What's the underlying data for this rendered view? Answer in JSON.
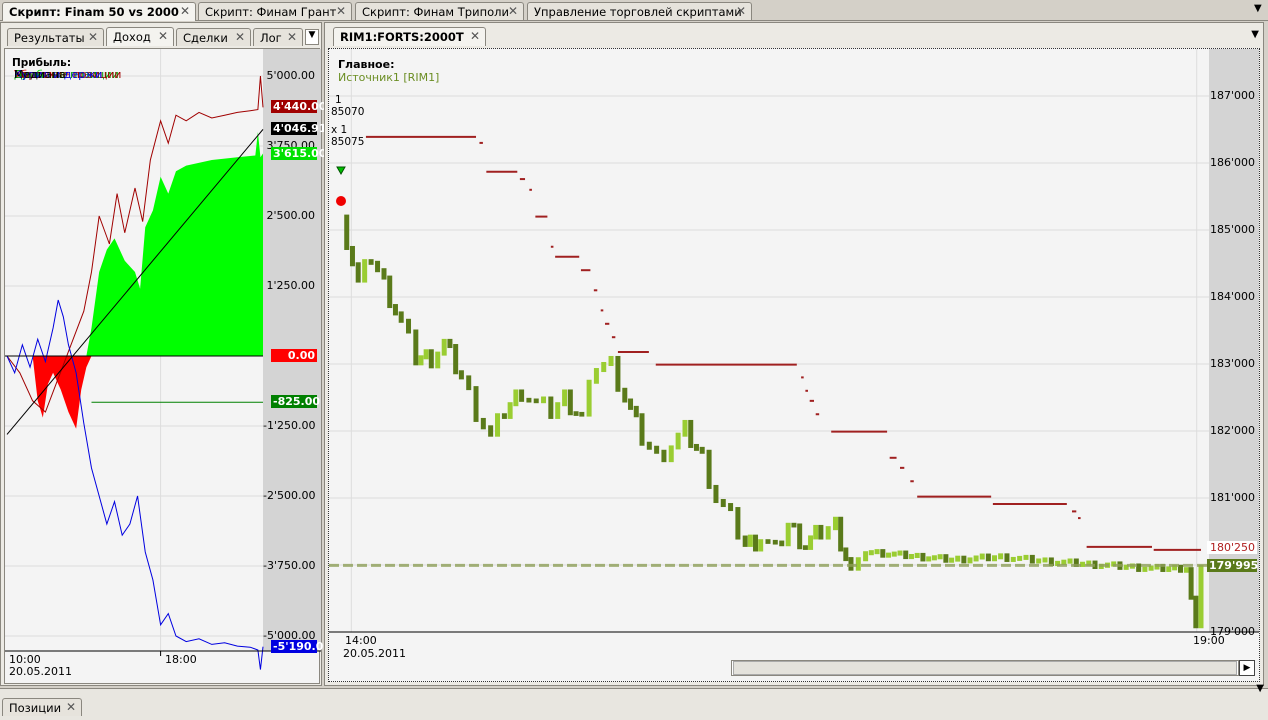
{
  "top_tabs": [
    {
      "label": "Скрипт: Finam 50 vs 2000",
      "active": true
    },
    {
      "label": "Скрипт: Финам Грант"
    },
    {
      "label": "Скрипт: Финам Триполи"
    },
    {
      "label": "Управление торговлей скриптами"
    }
  ],
  "left": {
    "tabs": [
      {
        "label": "Результаты"
      },
      {
        "label": "Доход",
        "active": true
      },
      {
        "label": "Сделки"
      },
      {
        "label": "Лог"
      }
    ],
    "legend": {
      "title": "Прибыль:",
      "items": [
        {
          "label": "Прибыль",
          "color": "#00e000"
        },
        {
          "label": "Убыток",
          "color": "#e00000"
        },
        {
          "label": "Длинные позиции",
          "color": "#00a000"
        },
        {
          "label": "Короткие позиции",
          "color": "#a00000"
        },
        {
          "label": "Купил и держи",
          "color": "#0000e0"
        },
        {
          "label": "Медиана",
          "color": "#000000"
        }
      ]
    },
    "y_ticks": [
      "5'000.00",
      "3'750.00",
      "2'500.00",
      "1'250.00",
      "-1'250.00",
      "-2'500.00",
      "-3'750.00",
      "-5'000.00"
    ],
    "value_boxes": {
      "profit": "4'440.00",
      "trend": "4'046.91",
      "long": "3'615.00",
      "zero": "0.00",
      "median": "-825.00",
      "buyhold": "-5'190.00"
    },
    "x_ticks": [
      "10:00",
      "18:00"
    ],
    "date": "20.05.2011"
  },
  "chart_data": [
    {
      "type": "area",
      "name": "equity",
      "ylim": [
        -5600,
        5000
      ],
      "x_range": [
        0,
        100
      ],
      "profit": [
        [
          0,
          0
        ],
        [
          5,
          -300
        ],
        [
          10,
          -800
        ],
        [
          15,
          -1000
        ],
        [
          20,
          -400
        ],
        [
          25,
          200
        ],
        [
          30,
          800
        ],
        [
          33,
          1500
        ],
        [
          36,
          2500
        ],
        [
          40,
          2000
        ],
        [
          43,
          2900
        ],
        [
          46,
          2200
        ],
        [
          50,
          3000
        ],
        [
          53,
          2400
        ],
        [
          56,
          3500
        ],
        [
          60,
          4200
        ],
        [
          63,
          3800
        ],
        [
          66,
          4300
        ],
        [
          70,
          4200
        ],
        [
          75,
          4350
        ],
        [
          80,
          4250
        ],
        [
          85,
          4300
        ],
        [
          90,
          4350
        ],
        [
          95,
          4380
        ],
        [
          98,
          4400
        ],
        [
          99,
          5000
        ],
        [
          100,
          4440
        ]
      ],
      "buyhold": [
        [
          0,
          0
        ],
        [
          3,
          -300
        ],
        [
          6,
          200
        ],
        [
          9,
          -200
        ],
        [
          12,
          300
        ],
        [
          15,
          -100
        ],
        [
          18,
          500
        ],
        [
          20,
          1000
        ],
        [
          22,
          700
        ],
        [
          24,
          200
        ],
        [
          27,
          -300
        ],
        [
          30,
          -1200
        ],
        [
          33,
          -2000
        ],
        [
          36,
          -2500
        ],
        [
          39,
          -3000
        ],
        [
          42,
          -2600
        ],
        [
          45,
          -3200
        ],
        [
          48,
          -3000
        ],
        [
          51,
          -2500
        ],
        [
          54,
          -3500
        ],
        [
          57,
          -4000
        ],
        [
          60,
          -4800
        ],
        [
          63,
          -4600
        ],
        [
          66,
          -5000
        ],
        [
          70,
          -5100
        ],
        [
          75,
          -5050
        ],
        [
          80,
          -5150
        ],
        [
          85,
          -5120
        ],
        [
          90,
          -5180
        ],
        [
          95,
          -5200
        ],
        [
          98,
          -5250
        ],
        [
          99,
          -5600
        ],
        [
          100,
          -5190
        ]
      ],
      "long": [
        [
          0,
          0
        ],
        [
          31,
          0
        ],
        [
          33,
          500
        ],
        [
          36,
          1500
        ],
        [
          39,
          1900
        ],
        [
          42,
          2100
        ],
        [
          46,
          1700
        ],
        [
          50,
          1500
        ],
        [
          52,
          1200
        ],
        [
          54,
          2300
        ],
        [
          57,
          2600
        ],
        [
          60,
          3200
        ],
        [
          63,
          2900
        ],
        [
          66,
          3300
        ],
        [
          70,
          3400
        ],
        [
          80,
          3500
        ],
        [
          90,
          3550
        ],
        [
          97,
          3580
        ],
        [
          98,
          4000
        ],
        [
          99,
          3550
        ],
        [
          100,
          3615
        ]
      ],
      "short": [
        [
          0,
          0
        ],
        [
          10,
          0
        ],
        [
          12,
          -800
        ],
        [
          14,
          -1100
        ],
        [
          16,
          -500
        ],
        [
          18,
          -300
        ],
        [
          21,
          -600
        ],
        [
          24,
          -1000
        ],
        [
          27,
          -1300
        ],
        [
          29,
          -600
        ],
        [
          31,
          -200
        ],
        [
          33,
          0
        ],
        [
          100,
          0
        ]
      ],
      "trend": [
        [
          0,
          -1400
        ],
        [
          100,
          4046.91
        ]
      ],
      "median": -825
    },
    {
      "type": "candlestick",
      "name": "RIM1",
      "ylim": [
        178800,
        187400
      ],
      "close": [
        [
          0,
          185200
        ],
        [
          2,
          184200
        ],
        [
          3.5,
          184600
        ],
        [
          5,
          184200
        ],
        [
          7,
          183600
        ],
        [
          8.7,
          183100
        ],
        [
          10.5,
          183100
        ],
        [
          12,
          183300
        ],
        [
          14,
          182800
        ],
        [
          15.7,
          182300
        ],
        [
          17.4,
          181900
        ],
        [
          19,
          182300
        ],
        [
          21,
          182600
        ],
        [
          22.7,
          182400
        ],
        [
          24.4,
          182300
        ],
        [
          26,
          182500
        ],
        [
          28,
          182200
        ],
        [
          29.7,
          183000
        ],
        [
          31.4,
          183000
        ],
        [
          33,
          182500
        ],
        [
          35,
          181900
        ],
        [
          36.7,
          181600
        ],
        [
          38.4,
          181800
        ],
        [
          40,
          182000
        ],
        [
          42,
          181600
        ],
        [
          43.6,
          181000
        ],
        [
          45.3,
          180700
        ],
        [
          47,
          180300
        ],
        [
          48.8,
          180400
        ],
        [
          50.5,
          180200
        ],
        [
          52,
          180600
        ],
        [
          54,
          180300
        ],
        [
          55.8,
          180500
        ],
        [
          57.5,
          180600
        ],
        [
          59.3,
          179900
        ],
        [
          61,
          180200
        ],
        [
          65,
          180150
        ],
        [
          71,
          180080
        ],
        [
          76.7,
          180120
        ],
        [
          82.6,
          180050
        ],
        [
          88.4,
          180000
        ],
        [
          94.2,
          179950
        ],
        [
          98.3,
          179950
        ],
        [
          99.4,
          179050
        ],
        [
          100,
          179995
        ]
      ],
      "stops": [
        [
          2.9,
          15.7,
          186390
        ],
        [
          16.1,
          16.5,
          186300
        ],
        [
          16.9,
          20.5,
          185870
        ],
        [
          20.8,
          21.4,
          185760
        ],
        [
          21.9,
          22.2,
          185600
        ],
        [
          22.6,
          24,
          185200
        ],
        [
          24.4,
          24.7,
          184750
        ],
        [
          24.9,
          27.7,
          184600
        ],
        [
          27.9,
          29,
          184400
        ],
        [
          29.4,
          29.8,
          184100
        ],
        [
          30.2,
          30.5,
          183800
        ],
        [
          30.7,
          31.2,
          183600
        ],
        [
          31.5,
          31.9,
          183400
        ],
        [
          32.2,
          35.8,
          183180
        ],
        [
          36.6,
          53,
          182990
        ],
        [
          53.5,
          53.8,
          182800
        ],
        [
          54,
          54.3,
          182600
        ],
        [
          54.5,
          55,
          182450
        ],
        [
          55.2,
          55.6,
          182250
        ],
        [
          57,
          63.5,
          181990
        ],
        [
          63.8,
          64.6,
          181600
        ],
        [
          65,
          65.5,
          181450
        ],
        [
          66.2,
          66.6,
          181250
        ],
        [
          67,
          75.6,
          181020
        ],
        [
          75.8,
          84.4,
          180910
        ],
        [
          85,
          85.5,
          180800
        ],
        [
          85.7,
          86,
          180700
        ],
        [
          86.7,
          94.3,
          180270
        ],
        [
          94.5,
          100,
          180225
        ]
      ],
      "dashed_level": 179995
    }
  ],
  "right": {
    "tab": "RIM1:FORTS:2000T",
    "legend_title": "Главное:",
    "source": "Источник1 [RIM1]",
    "orders": [
      "1",
      "85070",
      "x 1",
      "85075"
    ],
    "y_ticks": [
      "187'000",
      "186'000",
      "185'000",
      "184'000",
      "183'000",
      "182'000",
      "181'000",
      "179'000"
    ],
    "value_boxes": {
      "stop": "180'250",
      "last": "179'995"
    },
    "x_ticks": [
      "14:00",
      "19:00"
    ],
    "date": "20.05.2011"
  },
  "bottom_tabs": [
    {
      "label": "Позиции"
    }
  ]
}
